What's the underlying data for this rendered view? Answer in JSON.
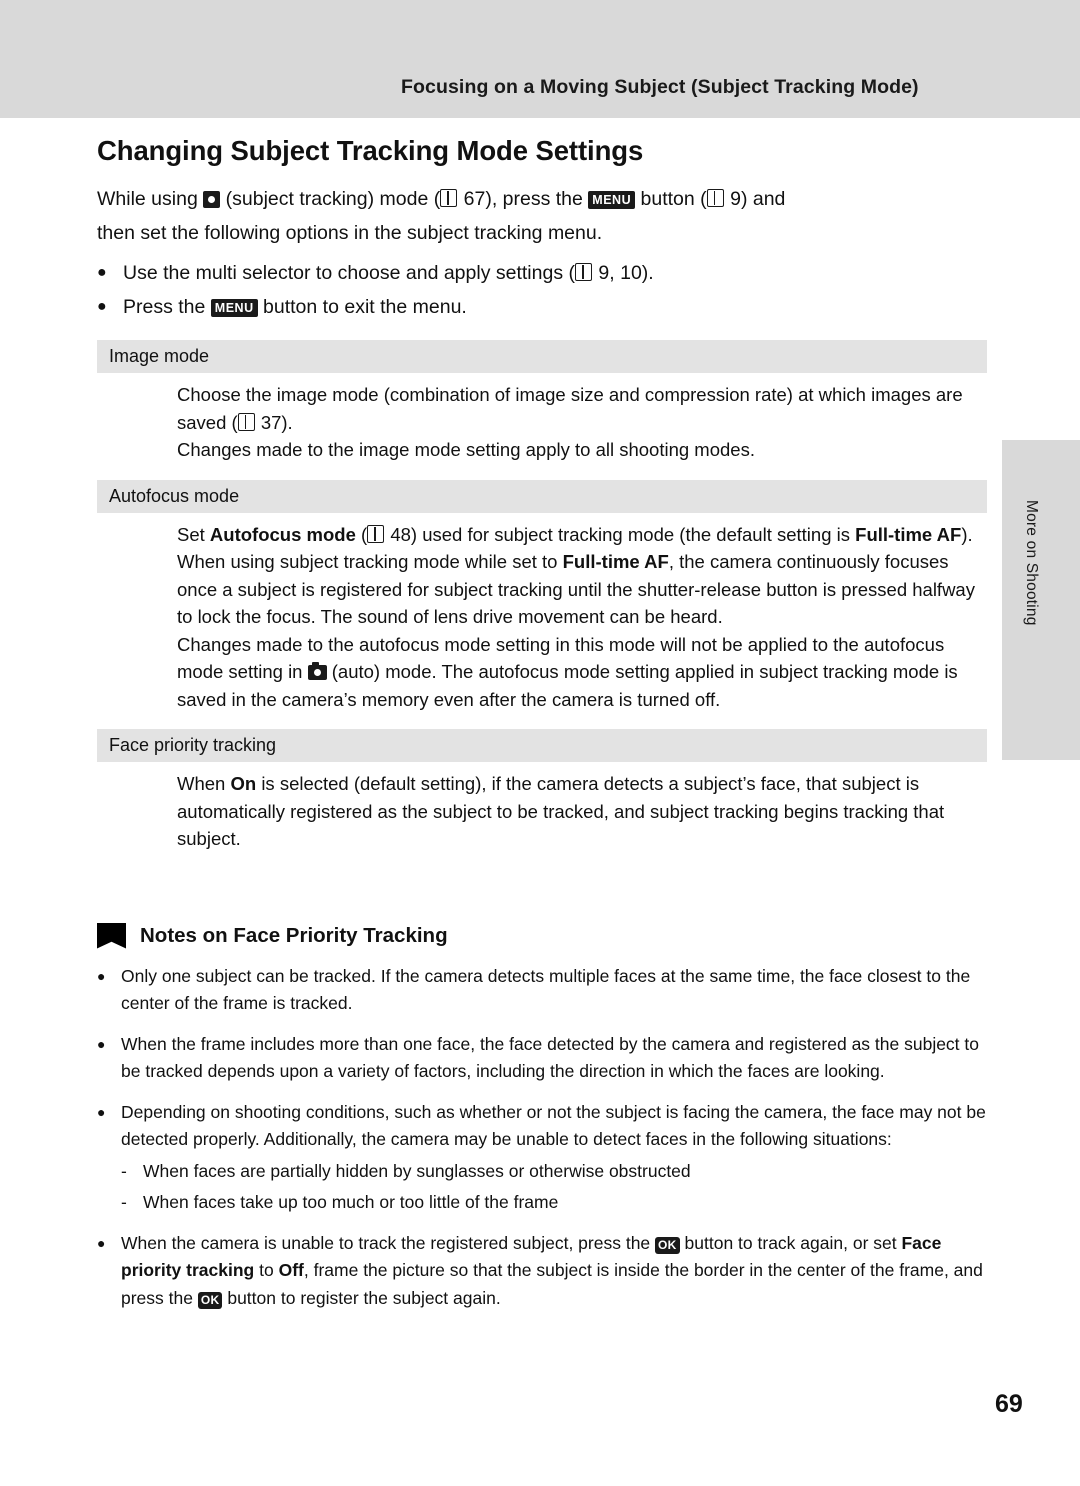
{
  "header": {
    "running_title": "Focusing on a Moving Subject (Subject Tracking Mode)"
  },
  "side_tab": {
    "label": "More on Shooting"
  },
  "title": "Changing Subject Tracking Mode Settings",
  "intro": {
    "line1_a": "While using",
    "line1_b": "(subject tracking) mode (",
    "line1_c": "67), press the",
    "line1_d": "button (",
    "line1_e": "9) and",
    "line2": "then set the following options in the subject tracking menu."
  },
  "bullets": [
    {
      "dot": "●",
      "text_a": "Use the multi selector to choose and apply settings (",
      "text_b": "9, 10)."
    },
    {
      "dot": "●",
      "text_a": "Press the",
      "text_b": "button to exit the menu."
    }
  ],
  "sections": [
    {
      "heading": "Image mode",
      "paragraphs": [
        "Choose the image mode (combination of image size and compression rate) at which images are saved (",
        "37).",
        "Changes made to the image mode setting apply to all shooting modes."
      ]
    },
    {
      "heading": "Autofocus mode",
      "p1_a": "Set",
      "p1_b": "Autofocus mode",
      "p1_c": "48) used for subject tracking mode (the default setting is",
      "p1_d": "Full-time AF",
      "p1_e": ").",
      "p2_a": "When using subject tracking mode while set to",
      "p2_b": "Full-time AF",
      "p2_c": ", the camera continuously focuses once a subject is registered for subject tracking until the shutter-release button is pressed halfway to lock the focus. The sound of lens drive movement can be heard.",
      "p3_a": "Changes made to the autofocus mode setting in this mode will not be applied to the autofocus mode setting in",
      "p3_b": "(auto) mode. The autofocus mode setting applied in subject tracking mode is saved in the camera’s memory even after the camera is turned off."
    },
    {
      "heading": "Face priority tracking",
      "p1_a": "When",
      "p1_b": "On",
      "p1_c": "is selected (default setting), if the camera detects a subject’s face, that subject is automatically registered as the subject to be tracked, and subject tracking begins tracking that subject."
    }
  ],
  "notes": {
    "title": "Notes on Face Priority Tracking",
    "items": [
      {
        "dot": "●",
        "text": "Only one subject can be tracked. If the camera detects multiple faces at the same time, the face closest to the center of the frame is tracked."
      },
      {
        "dot": "●",
        "text": "When the frame includes more than one face, the face detected by the camera and registered as the subject to be tracked depends upon a variety of factors, including the direction in which the faces are looking."
      },
      {
        "dot": "●",
        "text": "Depending on shooting conditions, such as whether or not the subject is facing the camera, the face may not be detected properly. Additionally, the camera may be unable to detect faces in the following situations:"
      }
    ],
    "sub_items": [
      {
        "dash": "-",
        "text": "When faces are partially hidden by sunglasses or otherwise obstructed"
      },
      {
        "dash": "-",
        "text": "When faces take up too much or too little of the frame"
      }
    ],
    "last_item": {
      "dot": "●",
      "a": "When the camera is unable to track the registered subject, press the",
      "b": "button to track again, or set",
      "c": "Face priority tracking",
      "d": "to",
      "e": "Off",
      "f": ", frame the picture so that the subject is inside the border in the center of the frame, and press the",
      "g": "button to register the subject again."
    }
  },
  "icons": {
    "menu": "MENU",
    "ok": "OK"
  },
  "page_number": "69"
}
